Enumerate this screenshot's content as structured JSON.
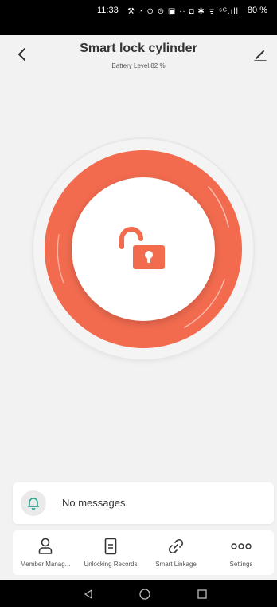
{
  "status_bar": {
    "time": "11:33",
    "icons_text": "⚒ ◔ ⊙ ⊙ ▣ ·· ◘ ✱ ᯤ ˢᴳ.ıll",
    "battery": "80 %"
  },
  "header": {
    "title": "Smart lock cylinder",
    "battery_level": "Battery Level:82 %"
  },
  "lock": {
    "state": "unlocked",
    "accent_color": "#f26b4f"
  },
  "messages": {
    "text": "No messages."
  },
  "bottom_nav": {
    "items": [
      {
        "label": "Member Manag...",
        "icon": "person-icon"
      },
      {
        "label": "Unlocking Records",
        "icon": "records-icon"
      },
      {
        "label": "Smart Linkage",
        "icon": "link-icon"
      },
      {
        "label": "Settings",
        "icon": "more-icon"
      }
    ]
  },
  "android_nav": {
    "buttons": [
      "back-triangle-icon",
      "home-circle-icon",
      "recents-square-icon"
    ]
  }
}
